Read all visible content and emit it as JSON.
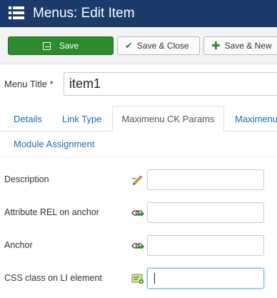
{
  "header": {
    "title": "Menus: Edit Item",
    "icon": "menu-list-icon",
    "background": "#1c3b6b"
  },
  "toolbar": {
    "save_label": "Save",
    "save_close_label": "Save & Close",
    "save_new_label": "Save & New",
    "save_color": "#2f8a2f"
  },
  "form": {
    "menu_title_label": "Menu Title *",
    "menu_title_value": "item1"
  },
  "tabs": {
    "details": "Details",
    "link_type": "Link Type",
    "maximenu_params": "Maximenu CK Params",
    "maximenu_more": "Maximenu",
    "module_assignment": "Module Assignment",
    "active": "Maximenu CK Params"
  },
  "fields": [
    {
      "label": "Description",
      "icon": "pencil-edit-icon",
      "value": ""
    },
    {
      "label": "Attribute REL on anchor",
      "icon": "link-arrow-icon",
      "value": ""
    },
    {
      "label": "Anchor",
      "icon": "link-arrow-icon",
      "value": ""
    },
    {
      "label": "CSS class on LI element",
      "icon": "css-class-icon",
      "value": ""
    }
  ]
}
